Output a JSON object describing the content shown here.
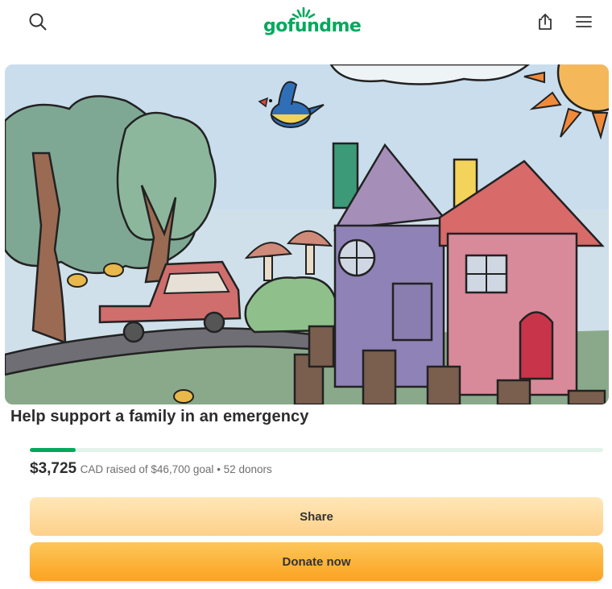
{
  "header": {
    "logo_text": "gofundme",
    "icons": [
      "search-icon",
      "share-icon",
      "menu-icon"
    ]
  },
  "campaign": {
    "title": "Help support a family in an emergency",
    "raised_amount": "$3,725",
    "raised_detail": "CAD raised of $46,700 goal",
    "separator": " • ",
    "donors": "52 donors",
    "progress_fraction": 0.08
  },
  "actions": {
    "share_label": "Share",
    "donate_label": "Donate now"
  },
  "colors": {
    "brand_green": "#02a95c",
    "donate_orange": "#fba321",
    "share_orange": "#fdd08a"
  }
}
